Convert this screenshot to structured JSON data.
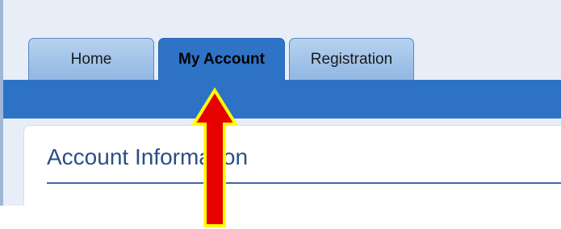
{
  "tabs": [
    {
      "label": "Home",
      "active": false
    },
    {
      "label": "My Account",
      "active": true
    },
    {
      "label": "Registration",
      "active": false
    }
  ],
  "panel": {
    "title": "Account Information"
  },
  "colors": {
    "nav_bar": "#2e72c6",
    "active_tab": "#2f73c7",
    "inactive_tab": "#a6c5ea",
    "title_text": "#2a4f85",
    "arrow_fill": "#e60000",
    "arrow_outline": "#ffff00"
  },
  "annotation": {
    "icon": "up-arrow-icon"
  }
}
